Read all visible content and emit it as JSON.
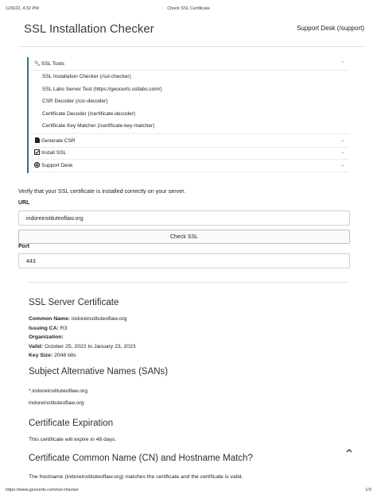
{
  "print": {
    "date": "12/6/22, 4:32 PM",
    "title": "Check SSL Certificate",
    "url": "https://www.geocerts.com/ssl-checker",
    "page": "1/3"
  },
  "header": {
    "brand": "SSL Installation Checker",
    "support_link": "Support Desk (/support)"
  },
  "menu": {
    "ssl_tools": {
      "label": "SSL Tools",
      "icon": "wrench-icon",
      "caret": "⌃"
    },
    "sub_items": [
      "SSL Installation Checker (/ssl-checker)",
      "SSL Labs Server Test (https://geocerts.ssllabs.com/)",
      "CSR Decoder (/csr-decoder)",
      "Certificate Decoder (/certificate-decoder)",
      "Certificate Key Matcher (/certificate-key-matcher)"
    ],
    "generate_csr": {
      "label": "Generate CSR",
      "icon": "file-icon",
      "caret": "⌄"
    },
    "install_ssl": {
      "label": "Install SSL",
      "icon": "check-square-icon",
      "caret": "⌄"
    },
    "support_desk": {
      "label": "Support Desk",
      "icon": "life-ring-icon",
      "caret": "⌄"
    }
  },
  "form": {
    "intro": "Verify that your SSL certificate is installed correctly on your server.",
    "url_label": "URL",
    "url_value": "indoreinstituteoflaw.org",
    "check_button": "Check SSL",
    "port_label": "Port",
    "port_value": "443"
  },
  "results": {
    "server_cert_title": "SSL Server Certificate",
    "common_name_label": "Common Name:",
    "common_name_value": "indoreinstituteoflaw.org",
    "issuing_ca_label": "Issuing CA:",
    "issuing_ca_value": "R3",
    "organization_label": "Organization:",
    "valid_label": "Valid:",
    "valid_value": "October 25, 2022 to January 23, 2023",
    "key_size_label": "Key Size:",
    "key_size_value": "2048 bits",
    "san_title": "Subject Alternative Names (SANs)",
    "san_items": [
      "*.indoreinstituteoflaw.org",
      "indoreinstituteoflaw.org"
    ],
    "expiration_title": "Certificate Expiration",
    "expiration_text": "This certificate will expire in 48 days.",
    "cn_match_title": "Certificate Common Name (CN) and Hostname Match?",
    "cn_match_text": "The hostname (indoreinstituteoflaw.org) matches the certificate and the certificate is valid."
  },
  "scroll_top_icon": "chevron-up-icon"
}
